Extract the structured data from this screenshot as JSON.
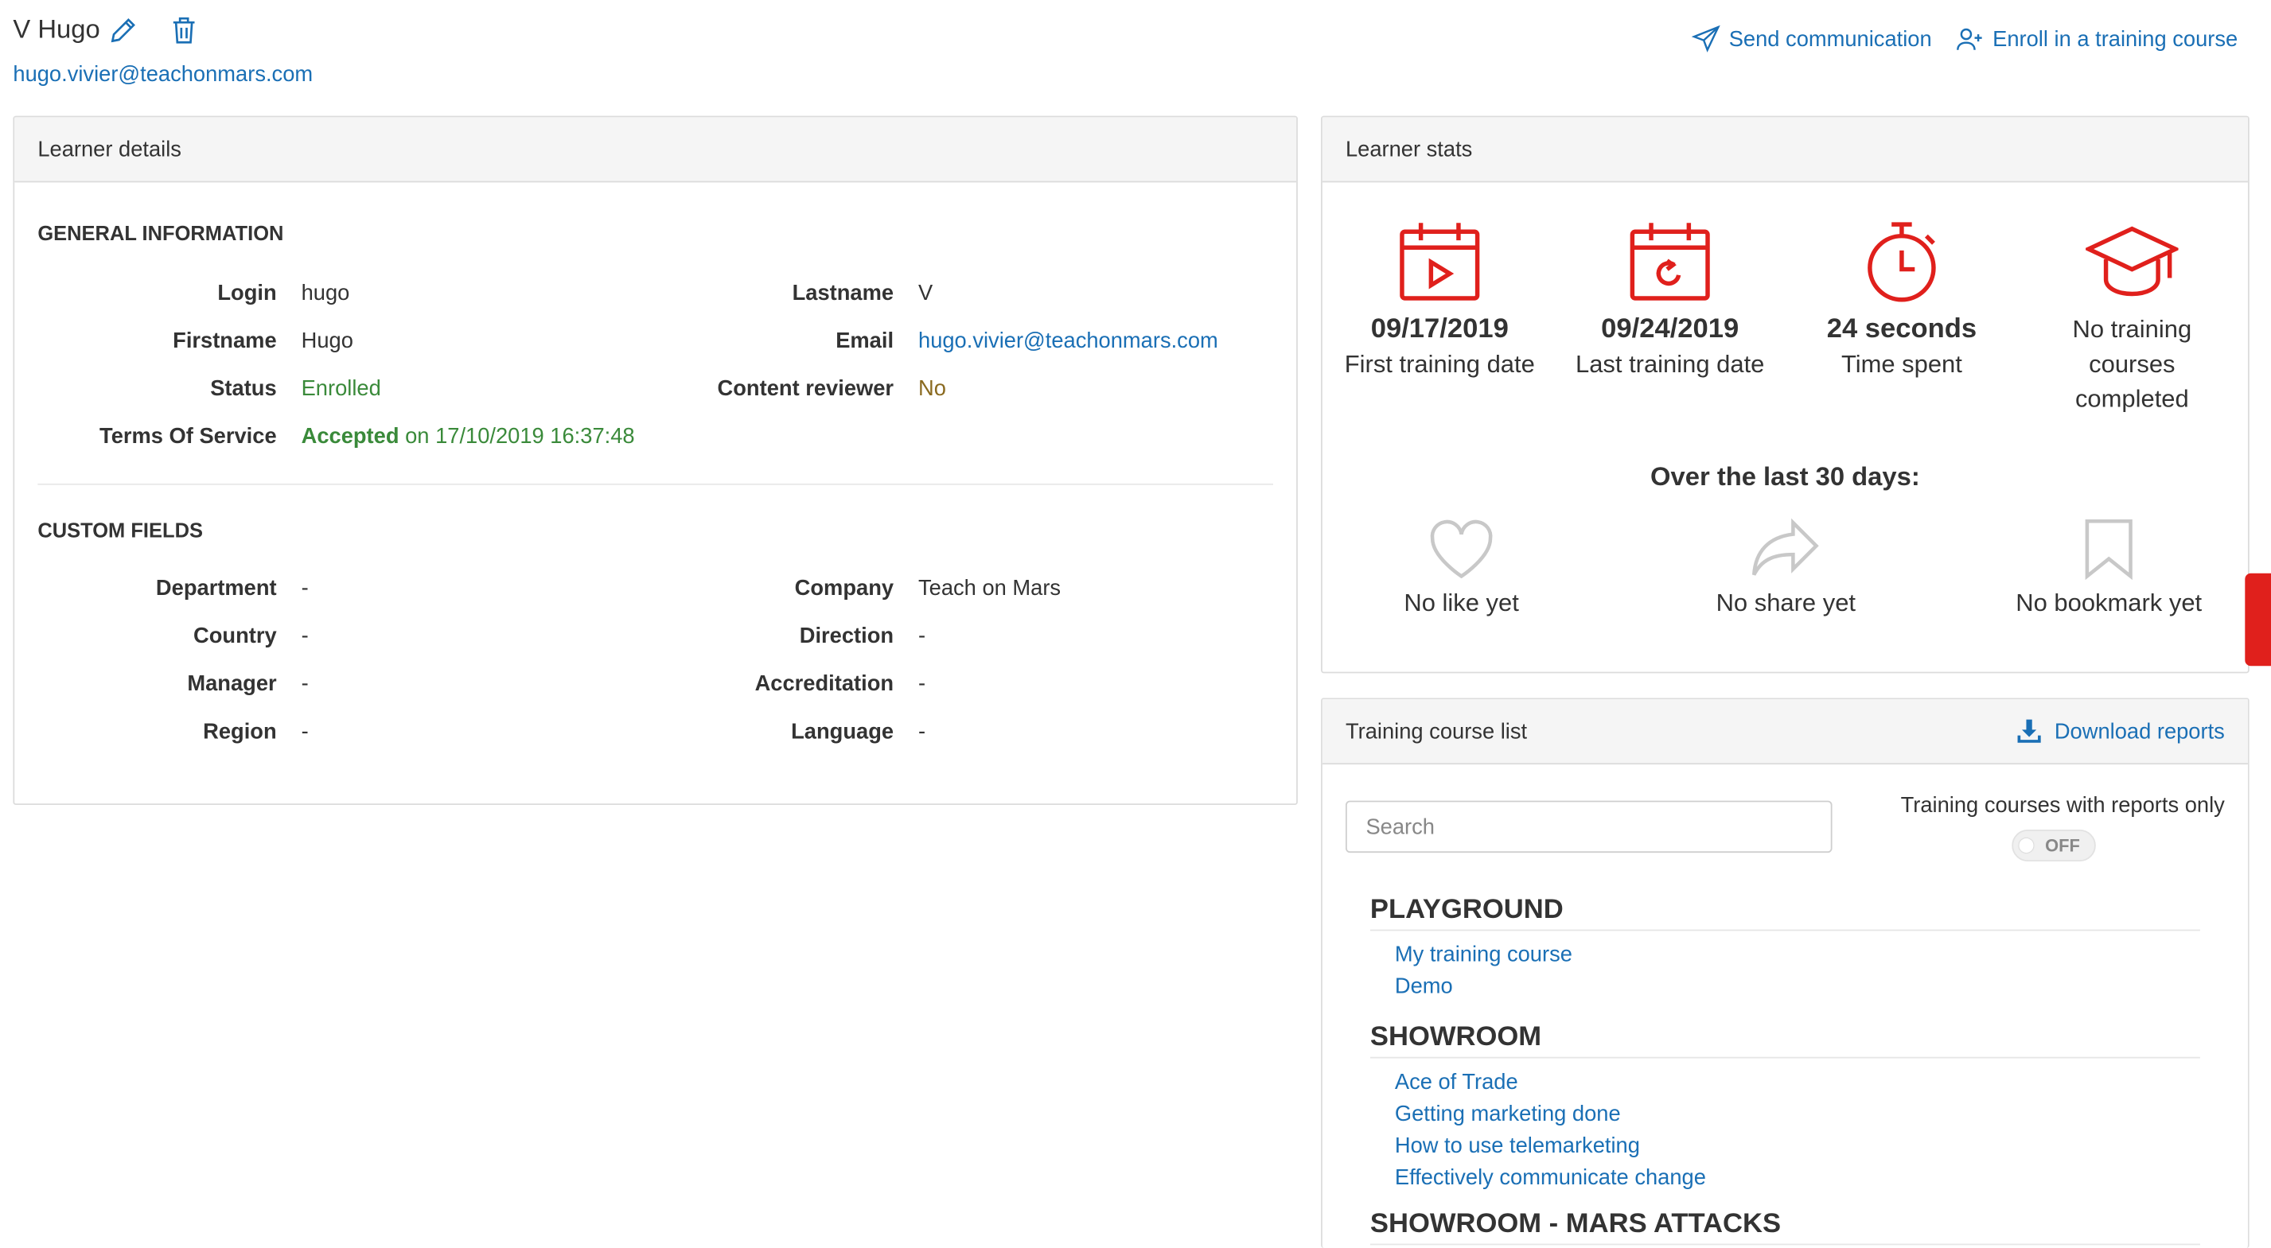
{
  "header": {
    "name": "V Hugo",
    "email": "hugo.vivier@teachonmars.com",
    "actions": [
      {
        "label": "Send communication",
        "icon": "paper-plane-icon"
      },
      {
        "label": "Enroll in a training course",
        "icon": "user-plus-icon"
      }
    ]
  },
  "learner_details": {
    "title": "Learner details",
    "general": {
      "heading": "GENERAL INFORMATION",
      "left": [
        {
          "label": "Login",
          "value": "hugo"
        },
        {
          "label": "Firstname",
          "value": "Hugo"
        },
        {
          "label": "Status",
          "value": "Enrolled"
        },
        {
          "label": "Terms Of Service",
          "value": "Accepted",
          "extra": "on 17/10/2019 16:37:48"
        }
      ],
      "right": [
        {
          "label": "Lastname",
          "value": "V"
        },
        {
          "label": "Email",
          "value": "hugo.vivier@teachonmars.com"
        },
        {
          "label": "Content reviewer",
          "value": "No"
        }
      ]
    },
    "custom": {
      "heading": "CUSTOM FIELDS",
      "left": [
        {
          "label": "Department",
          "value": "-"
        },
        {
          "label": "Country",
          "value": "-"
        },
        {
          "label": "Manager",
          "value": "-"
        },
        {
          "label": "Region",
          "value": "-"
        }
      ],
      "right": [
        {
          "label": "Company",
          "value": "Teach on Mars"
        },
        {
          "label": "Direction",
          "value": "-"
        },
        {
          "label": "Accreditation",
          "value": "-"
        },
        {
          "label": "Language",
          "value": "-"
        }
      ]
    }
  },
  "learner_stats": {
    "title": "Learner stats",
    "top": [
      {
        "value": "09/17/2019",
        "label": "First training date",
        "icon": "calendar-play-icon"
      },
      {
        "value": "09/24/2019",
        "label": "Last training date",
        "icon": "calendar-refresh-icon"
      },
      {
        "value": "24 seconds",
        "label": "Time spent",
        "icon": "stopwatch-icon"
      },
      {
        "value": "",
        "label": "No training courses completed",
        "icon": "graduation-cap-icon"
      }
    ],
    "last30_heading": "Over the last 30 days:",
    "bottom": [
      {
        "label": "No like yet",
        "icon": "heart-icon"
      },
      {
        "label": "No share yet",
        "icon": "share-icon"
      },
      {
        "label": "No bookmark yet",
        "icon": "bookmark-icon"
      }
    ],
    "accent_color": "#e0201c"
  },
  "training_list": {
    "title": "Training course list",
    "download_label": "Download reports",
    "search_placeholder": "Search",
    "toggle_label": "Training courses with reports only",
    "toggle_state": "OFF",
    "groups": [
      {
        "name": "PLAYGROUND",
        "courses": [
          "My training course",
          "Demo"
        ]
      },
      {
        "name": "SHOWROOM",
        "courses": [
          "Ace of Trade",
          "Getting marketing done",
          "How to use telemarketing",
          "Effectively communicate change"
        ]
      },
      {
        "name": "SHOWROOM - MARS ATTACKS",
        "courses": []
      }
    ]
  },
  "colors": {
    "link": "#1a6fb5",
    "success": "#3a8a3a",
    "warning": "#8a6a20"
  }
}
